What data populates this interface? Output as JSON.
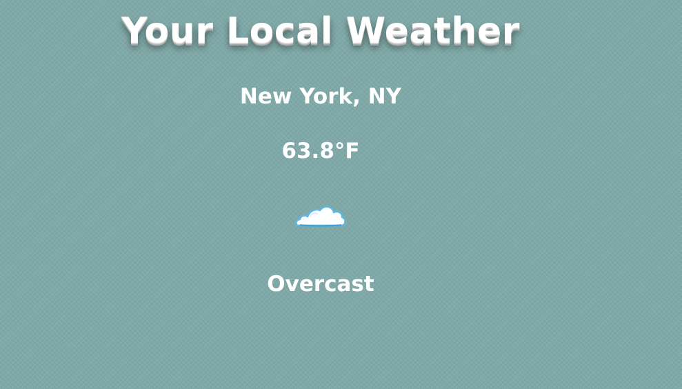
{
  "header": {
    "title": "Your Local Weather"
  },
  "weather": {
    "location": "New York, NY",
    "temperature": "63.8°F",
    "condition": "Overcast",
    "icon": "cloud-icon"
  },
  "colors": {
    "background": "#7fa9a8",
    "text": "#ffffff",
    "cloud_fill": "#ffffff",
    "cloud_outline": "#5cb8e6"
  }
}
